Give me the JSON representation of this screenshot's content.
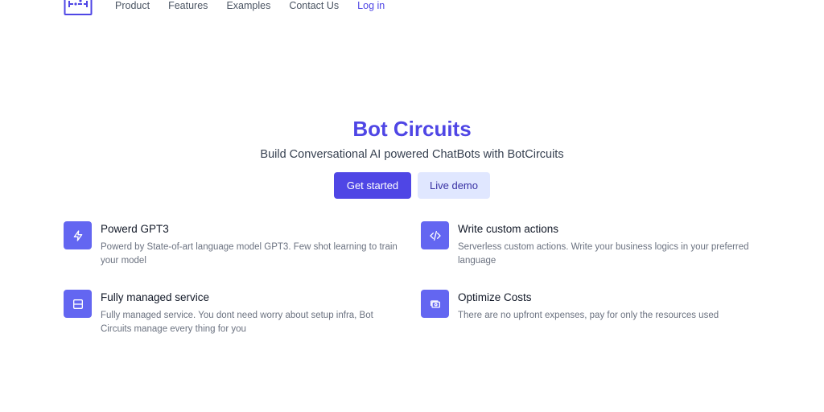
{
  "nav": {
    "links": [
      "Product",
      "Features",
      "Examples",
      "Contact Us"
    ],
    "login": "Log in"
  },
  "hero": {
    "title": "Bot Circuits",
    "subtitle": "Build Conversational AI powered ChatBots with BotCircuits",
    "primary_button": "Get started",
    "secondary_button": "Live demo"
  },
  "features": [
    {
      "title": "Powerd GPT3",
      "description": "Powerd by State-of-art language model GPT3. Few shot learning to train your model",
      "icon": "lightning-icon"
    },
    {
      "title": "Write custom actions",
      "description": "Serverless custom actions. Write your business logics in your preferred language",
      "icon": "code-icon"
    },
    {
      "title": "Fully managed service",
      "description": "Fully managed service. You dont need worry about setup infra, Bot Circuits manage every thing for you",
      "icon": "server-icon"
    },
    {
      "title": "Optimize Costs",
      "description": "There are no upfront expenses, pay for only the resources used",
      "icon": "cash-icon"
    }
  ],
  "colors": {
    "accent": "#4f46e5",
    "icon_bg": "#6366f1",
    "secondary_btn_bg": "#e0e7ff"
  }
}
